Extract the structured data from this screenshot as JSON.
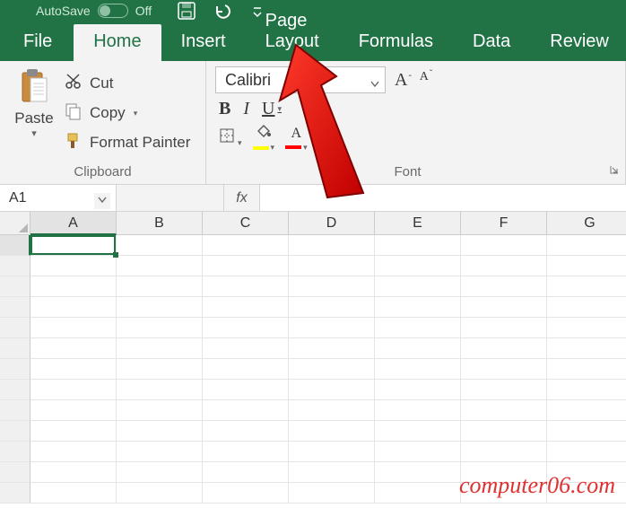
{
  "titlebar": {
    "autosave_label": "AutoSave",
    "autosave_state": "Off"
  },
  "tabs": [
    "File",
    "Home",
    "Insert",
    "Page Layout",
    "Formulas",
    "Data",
    "Review"
  ],
  "active_tab_index": 1,
  "clipboard": {
    "paste": "Paste",
    "cut": "Cut",
    "copy": "Copy",
    "format_painter": "Format Painter",
    "group_label": "Clipboard"
  },
  "font": {
    "name": "Calibri",
    "bold": "B",
    "italic": "I",
    "underline": "U",
    "inc": "A",
    "dec": "A",
    "font_color_letter": "A",
    "group_label": "Font"
  },
  "namebox": {
    "value": "A1"
  },
  "fx": "fx",
  "columns": [
    "A",
    "B",
    "C",
    "D",
    "E",
    "F",
    "G"
  ],
  "row_count": 13,
  "selected": {
    "col": 0,
    "row": 0
  },
  "watermark": "computer06.com",
  "annotation": {
    "points_to": "Page Layout"
  }
}
